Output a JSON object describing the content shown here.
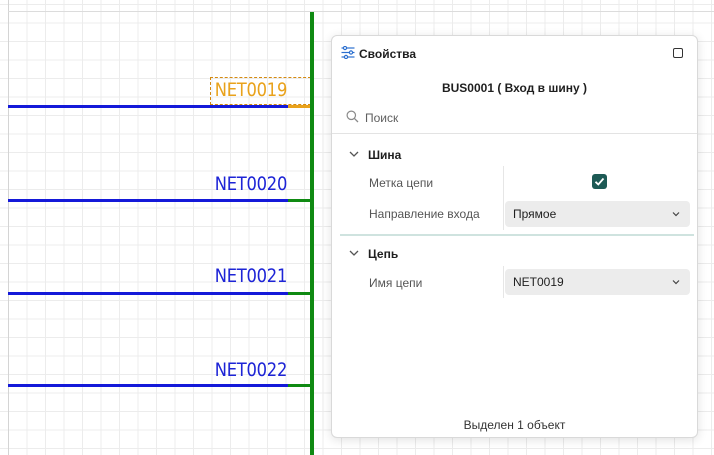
{
  "canvas": {
    "nets": [
      {
        "name": "NET0019",
        "selected": true
      },
      {
        "name": "NET0020",
        "selected": false
      },
      {
        "name": "NET0021",
        "selected": false
      },
      {
        "name": "NET0022",
        "selected": false
      }
    ]
  },
  "panel": {
    "title": "Свойства",
    "object_title": "BUS0001 ( Вход в шину )",
    "search": {
      "placeholder": "Поиск",
      "value": ""
    },
    "sections": {
      "bus": {
        "label": "Шина",
        "net_label_prop": "Метка цепи",
        "net_label_checked": true,
        "direction_prop": "Направление входа",
        "direction_value": "Прямое"
      },
      "net": {
        "label": "Цепь",
        "net_name_prop": "Имя цепи",
        "net_name_value": "NET0019"
      }
    },
    "status": "Выделен 1 объект"
  },
  "colors": {
    "net_wire": "#1419d9",
    "net_label": "#1d24d6",
    "bus": "#0f8a12",
    "selection": "#e9a21b",
    "checkbox_accent": "#1d5a55"
  },
  "icons": {
    "panel": "properties-sliders-icon",
    "maximize": "square-icon",
    "search": "search-icon",
    "section_toggle": "chevron-down-icon"
  }
}
